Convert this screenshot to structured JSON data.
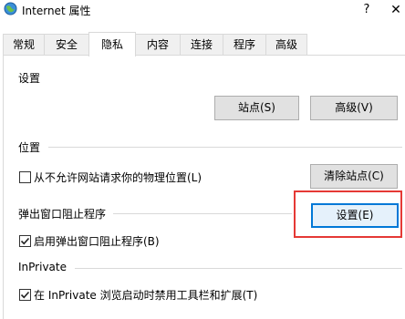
{
  "window": {
    "title": "Internet 属性",
    "help_label": "?",
    "close_label": "✕",
    "icon": "internet-options-icon"
  },
  "tabs": [
    {
      "label": "常规",
      "active": false
    },
    {
      "label": "安全",
      "active": false
    },
    {
      "label": "隐私",
      "active": true
    },
    {
      "label": "内容",
      "active": false
    },
    {
      "label": "连接",
      "active": false
    },
    {
      "label": "程序",
      "active": false
    },
    {
      "label": "高级",
      "active": false
    }
  ],
  "settings": {
    "heading": "设置",
    "sites_button": "站点(S)",
    "advanced_button": "高级(V)"
  },
  "location": {
    "heading": "位置",
    "checkbox_label": "从不允许网站请求你的物理位置(L)",
    "checked": false,
    "clear_sites_button": "清除站点(C)"
  },
  "popup_blocker": {
    "heading": "弹出窗口阻止程序",
    "checkbox_label": "启用弹出窗口阻止程序(B)",
    "checked": true,
    "settings_button": "设置(E)"
  },
  "inprivate": {
    "heading": "InPrivate",
    "checkbox_label": "在 InPrivate 浏览启动时禁用工具栏和扩展(T)",
    "checked": true
  },
  "colors": {
    "accent": "#0078d7",
    "highlight": "#e53935",
    "separator": "#d9d9d9"
  }
}
